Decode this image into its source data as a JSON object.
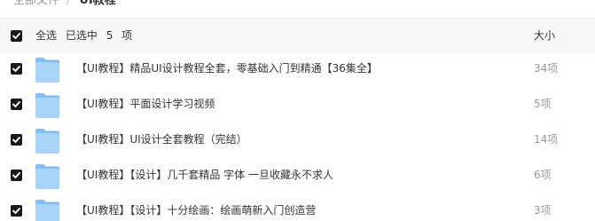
{
  "breadcrumb": {
    "parent": "全部文件",
    "separator": "/",
    "current": "UI教程"
  },
  "header": {
    "select_all": "全选",
    "selected_prefix": "已选中",
    "selected_count": "5",
    "selected_unit": "项",
    "size_column": "大小"
  },
  "files": [
    {
      "name": "【UI教程】精品UI设计教程全套，零基础入门到精通【36集全】",
      "size": "34项",
      "checked": true,
      "icon": "folder-icon"
    },
    {
      "name": "【UI教程】平面设计学习视频",
      "size": "5项",
      "checked": true,
      "icon": "folder-icon"
    },
    {
      "name": "【UI教程】UI设计全套教程（完结）",
      "size": "14项",
      "checked": true,
      "icon": "folder-icon"
    },
    {
      "name": "【UI教程】【设计】几千套精品 字体 一旦收藏永不求人",
      "size": "6项",
      "checked": true,
      "icon": "folder-icon"
    },
    {
      "name": "【UI教程】【设计】十分绘画：绘画萌新入门创造营",
      "size": "3项",
      "checked": true,
      "icon": "folder-icon"
    }
  ],
  "colors": {
    "checkbox": "#1a1a1a",
    "folder_body": "#a9d4f8",
    "folder_tab": "#7fbdf3",
    "header_bg": "#f6f7f9"
  }
}
